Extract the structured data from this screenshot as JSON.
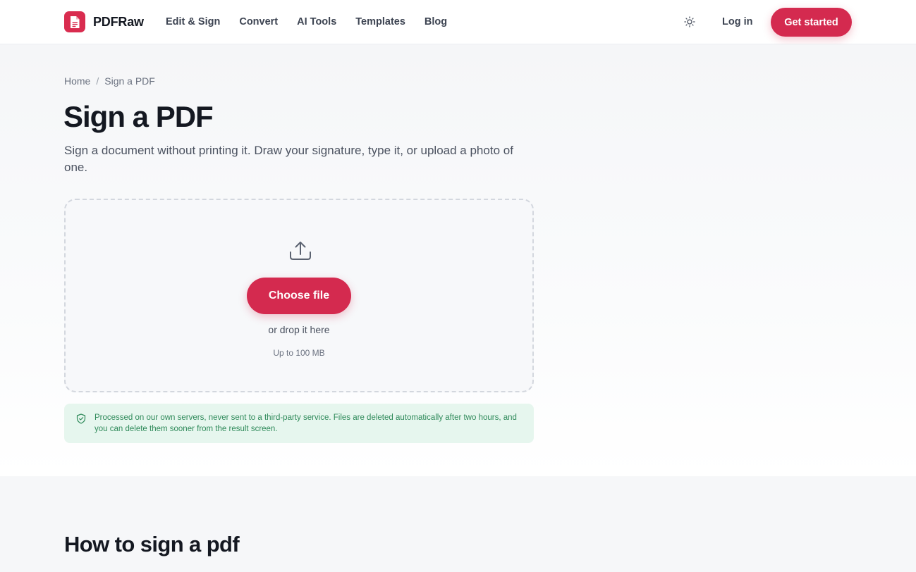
{
  "brand": {
    "name": "PDFRaw",
    "logo_icon": "pdf-document-icon",
    "color": "#d42a4f"
  },
  "nav": {
    "items": [
      "Edit & Sign",
      "Convert",
      "AI Tools",
      "Templates",
      "Blog"
    ],
    "theme_icon": "sun-icon",
    "login_label": "Log in",
    "cta_label": "Get started"
  },
  "breadcrumb": {
    "items": [
      "Home",
      "Sign a PDF"
    ],
    "separator": "/"
  },
  "hero": {
    "title": "Sign a PDF",
    "description": "Sign a document without printing it. Draw your signature, type it, or upload a photo of one."
  },
  "dropzone": {
    "icon": "upload-icon",
    "button_label": "Choose file",
    "drop_text": "or drop it here",
    "size_limit": "Up to 100 MB"
  },
  "privacy": {
    "icon": "shield-check-icon",
    "text": "Processed on our own servers, never sent to a third-party service. Files are deleted automatically after two hours, and you can delete them sooner from the result screen.",
    "accent": "#2f8a5a"
  },
  "howto": {
    "title": "How to sign a pdf"
  }
}
